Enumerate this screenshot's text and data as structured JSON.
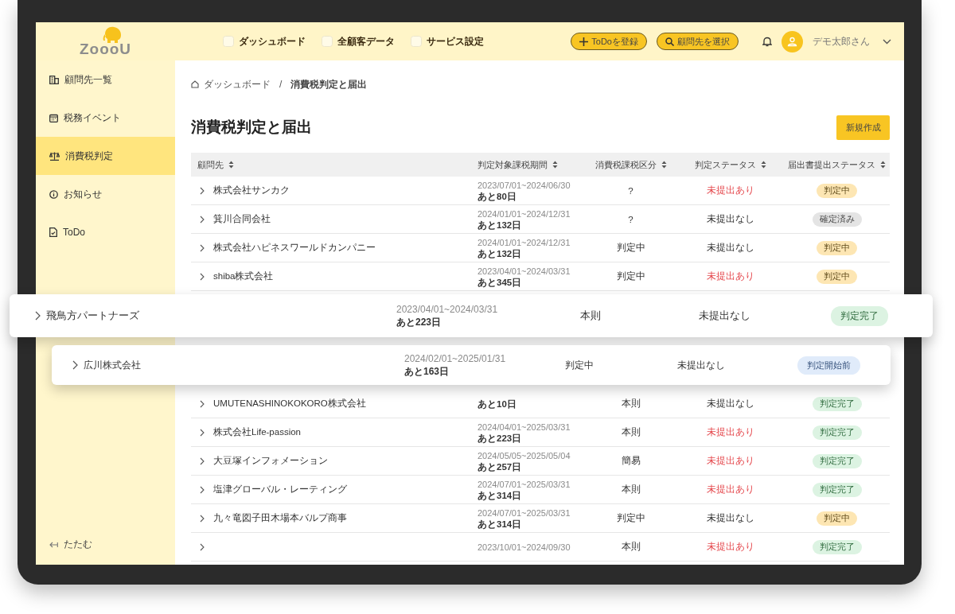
{
  "header": {
    "logo": "ZoooU",
    "nav": [
      {
        "label": "ダッシュボード"
      },
      {
        "label": "全顧客データ"
      },
      {
        "label": "サービス設定"
      }
    ],
    "buttons": [
      {
        "label": "ToDoを登録",
        "kind": "add"
      },
      {
        "label": "顧問先を選択",
        "kind": "search"
      }
    ],
    "user": "デモ太郎さん"
  },
  "sidebar": {
    "items": [
      {
        "label": "顧問先一覧",
        "kind": "building",
        "selected": false
      },
      {
        "label": "税務イベント",
        "kind": "calendar",
        "selected": false
      },
      {
        "label": "消費税判定",
        "kind": "scale",
        "selected": true
      },
      {
        "label": "お知らせ",
        "kind": "info",
        "selected": false
      },
      {
        "label": "ToDo",
        "kind": "document",
        "selected": false
      }
    ],
    "collapse": "たたむ"
  },
  "breadcrumb": {
    "items": [
      "ダッシュボード",
      "消費税判定と届出"
    ],
    "separator": "/"
  },
  "page": {
    "title": "消費税判定と届出",
    "new_button": "新規作成"
  },
  "table": {
    "columns": [
      "顧問先",
      "判定対象課税期間",
      "消費税課税区分",
      "判定ステータス",
      "届出書提出ステータス"
    ],
    "rows": [
      {
        "floating": false,
        "name": "株式会社サンカク",
        "period": "2023/07/01~2024/06/30",
        "remaining": "あと80日",
        "category": "?",
        "status": "未提出あり",
        "overdue": true,
        "badge": {
          "label": "判定中",
          "kind": "in_progress"
        }
      },
      {
        "floating": false,
        "name": "箕川合同会社",
        "period": "2024/01/01~2024/12/31",
        "remaining": "あと132日",
        "category": "?",
        "status": "未提出なし",
        "overdue": false,
        "badge": {
          "label": "確定済み",
          "kind": "confirmed"
        }
      },
      {
        "floating": false,
        "name": "株式会社ハピネスワールドカンパニー",
        "period": "2024/01/01~2024/12/31",
        "remaining": "あと132日",
        "category": "判定中",
        "status": "未提出なし",
        "overdue": false,
        "badge": {
          "label": "判定中",
          "kind": "in_progress"
        }
      },
      {
        "floating": false,
        "name": "shiba株式会社",
        "period": "2023/04/01~2024/03/31",
        "remaining": "あと345日",
        "category": "判定中",
        "status": "未提出あり",
        "overdue": true,
        "badge": {
          "label": "判定中",
          "kind": "in_progress"
        }
      },
      {
        "floating": true,
        "name": "飛鳥方パートナーズ",
        "period": "2023/04/01~2024/03/31",
        "remaining": "あと223日",
        "category": "本則",
        "status": "未提出なし",
        "overdue": false,
        "badge": {
          "label": "判定完了",
          "kind": "done"
        }
      },
      {
        "floating": true,
        "name": "広川株式会社",
        "period": "2024/02/01~2025/01/31",
        "remaining": "あと163日",
        "category": "判定中",
        "status": "未提出なし",
        "overdue": false,
        "badge": {
          "label": "判定開始前",
          "kind": "not_started"
        }
      },
      {
        "floating": false,
        "name": "UMUTENASHINOKOKORO株式会社",
        "remaining": "あと10日",
        "category": "本則",
        "status": "未提出なし",
        "overdue": false,
        "badge": {
          "label": "判定完了",
          "kind": "done"
        }
      },
      {
        "floating": false,
        "name": "株式会社Life-passion",
        "period": "2024/04/01~2025/03/31",
        "remaining": "あと223日",
        "category": "本則",
        "status": "未提出あり",
        "overdue": true,
        "badge": {
          "label": "判定完了",
          "kind": "done"
        }
      },
      {
        "floating": false,
        "name": "大豆塚インフォメーション",
        "period": "2024/05/05~2025/05/04",
        "remaining": "あと257日",
        "category": "簡易",
        "status": "未提出あり",
        "overdue": true,
        "badge": {
          "label": "判定完了",
          "kind": "done"
        }
      },
      {
        "floating": false,
        "name": "塩津グローバル・レーティング",
        "period": "2024/07/01~2025/03/31",
        "remaining": "あと314日",
        "category": "本則",
        "status": "未提出あり",
        "overdue": true,
        "badge": {
          "label": "判定完了",
          "kind": "done"
        }
      },
      {
        "floating": false,
        "name": "九々竜図子田木場本バルプ商事",
        "period": "2024/07/01~2025/03/31",
        "remaining": "あと314日",
        "category": "判定中",
        "status": "未提出なし",
        "overdue": false,
        "badge": {
          "label": "判定中",
          "kind": "in_progress"
        }
      },
      {
        "floating": false,
        "period": "2023/10/01~2024/09/30",
        "category": "本則",
        "status": "未提出あり",
        "overdue": true,
        "badge": {
          "label": "判定完了",
          "kind": "done"
        }
      }
    ]
  }
}
